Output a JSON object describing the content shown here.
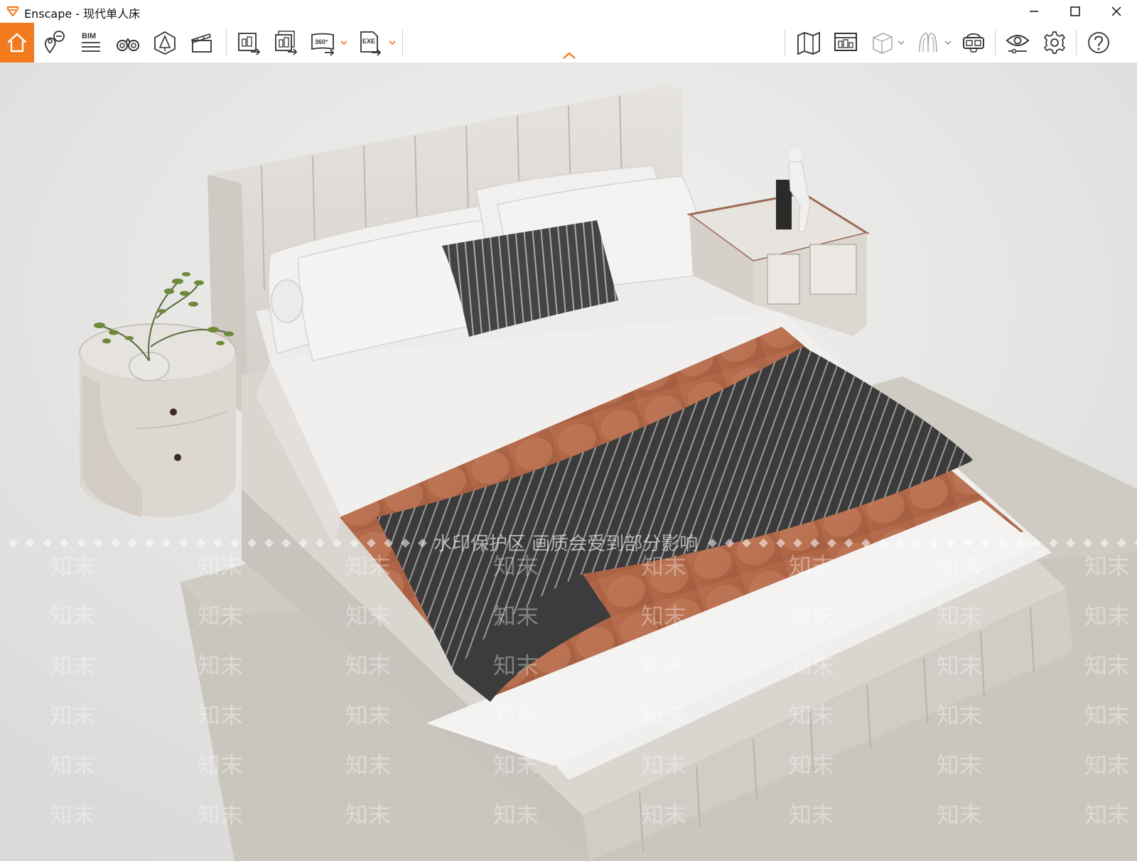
{
  "window": {
    "title": "Enscape - 现代单人床",
    "buttons": [
      "minimize",
      "maximize",
      "close"
    ]
  },
  "toolbar": {
    "left_tools": [
      {
        "name": "home-icon",
        "label": ""
      },
      {
        "name": "views-icon",
        "label": ""
      },
      {
        "name": "bim-icon",
        "label": "BIM"
      },
      {
        "name": "binoculars-icon",
        "label": ""
      },
      {
        "name": "asset-library-icon",
        "label": ""
      },
      {
        "name": "video-editor-icon",
        "label": ""
      },
      {
        "name": "render-screenshot-icon",
        "label": ""
      },
      {
        "name": "batch-render-icon",
        "label": ""
      },
      {
        "name": "panorama-icon",
        "label": "360°"
      },
      {
        "name": "export-exe-icon",
        "label": "EXE"
      }
    ],
    "right_tools": [
      {
        "name": "map-icon"
      },
      {
        "name": "presentation-icon"
      },
      {
        "name": "cube-icon"
      },
      {
        "name": "material-icon"
      },
      {
        "name": "vr-headset-icon"
      },
      {
        "name": "visual-settings-icon"
      },
      {
        "name": "settings-gear-icon"
      },
      {
        "name": "help-icon"
      }
    ],
    "accent_color": "#f47a20"
  },
  "viewport": {
    "watermark_banner": "水印保护区 画质会受到部分影响",
    "watermark_text": "知末"
  }
}
